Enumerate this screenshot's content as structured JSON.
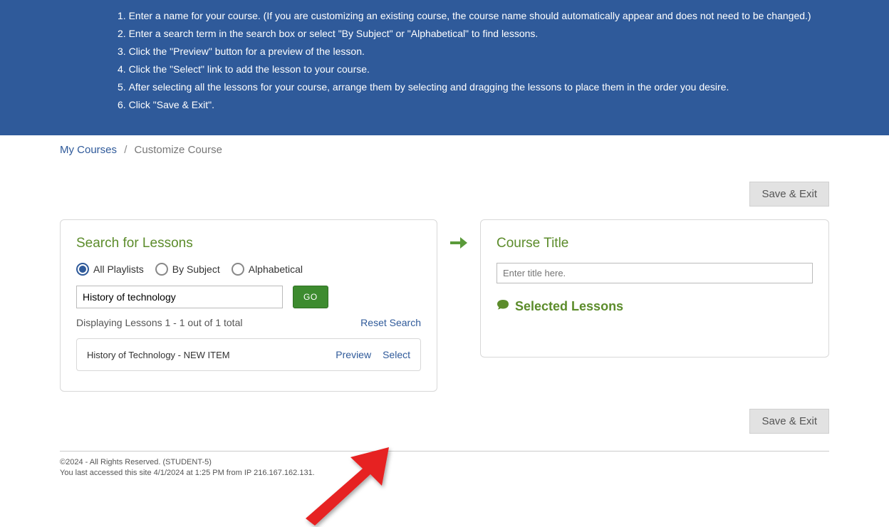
{
  "instructions": [
    "Enter a name for your course. (If you are customizing an existing course, the course name should automatically appear and does not need to be changed.)",
    "Enter a search term in the search box or select \"By Subject\" or \"Alphabetical\" to find lessons.",
    "Click the \"Preview\" button for a preview of the lesson.",
    "Click the \"Select\" link to add the lesson to your course.",
    "After selecting all the lessons for your course, arrange them by selecting and dragging the lessons to place them in the order you desire.",
    "Click \"Save & Exit\"."
  ],
  "breadcrumb": {
    "link": "My Courses",
    "current": "Customize Course",
    "sep": "/"
  },
  "buttons": {
    "save_exit": "Save & Exit",
    "go": "GO"
  },
  "left": {
    "title": "Search for Lessons",
    "radios": {
      "all": "All Playlists",
      "subject": "By Subject",
      "alpha": "Alphabetical"
    },
    "search_value": "History of technology",
    "results_status": "Displaying Lessons 1 - 1 out of 1 total",
    "reset": "Reset Search",
    "lesson": {
      "title": "History of Technology - NEW ITEM",
      "preview": "Preview",
      "select": "Select"
    }
  },
  "right": {
    "title": "Course Title",
    "placeholder": "Enter title here.",
    "selected": "Selected Lessons"
  },
  "footer": {
    "line1": "©2024 - All Rights Reserved. (STUDENT-5)",
    "line2": "You last accessed this site 4/1/2024 at 1:25 PM from IP 216.167.162.131."
  }
}
